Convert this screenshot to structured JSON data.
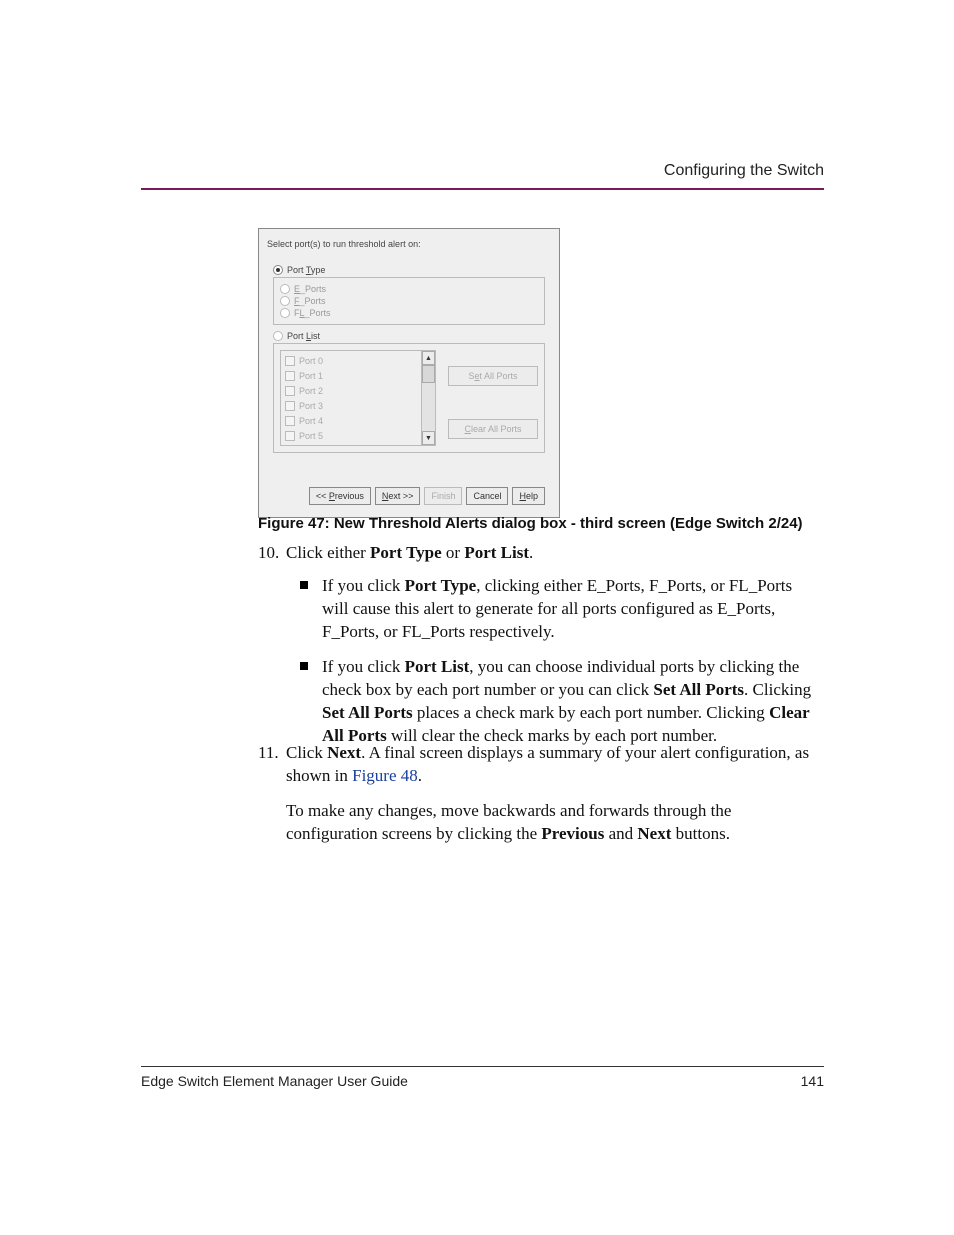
{
  "header": {
    "title": "Configuring the Switch"
  },
  "dialog": {
    "instruction": "Select port(s) to run threshold alert on:",
    "port_type_label_pre": "Port ",
    "port_type_label_u": "T",
    "port_type_label_post": "ype",
    "e_ports_u": "E",
    "e_ports_rest": "_Ports",
    "f_ports_u": "F",
    "f_ports_rest": "_Ports",
    "fl_ports_pre": "F",
    "fl_ports_u": "L",
    "fl_ports_rest": "_Ports",
    "port_list_label_pre": "Port ",
    "port_list_label_u": "L",
    "port_list_label_post": "ist",
    "ports": [
      "Port 0",
      "Port 1",
      "Port 2",
      "Port 3",
      "Port 4",
      "Port 5"
    ],
    "set_all_pre": "S",
    "set_all_u": "e",
    "set_all_post": "t All Ports",
    "clear_all_u": "C",
    "clear_all_post": "lear All Ports",
    "buttons": {
      "previous_pre": "<< ",
      "previous_u": "P",
      "previous_post": "revious",
      "next_u": "N",
      "next_post": "ext >>",
      "finish": "Finish",
      "cancel": "Cancel",
      "help_u": "H",
      "help_post": "elp"
    }
  },
  "caption": "Figure 47:  New Threshold Alerts dialog box - third screen (Edge Switch 2/24)",
  "step10": {
    "num": "10.",
    "text_pre": "Click either ",
    "pt": "Port Type",
    "or": " or ",
    "pl": "Port List",
    "period": ".",
    "bullet1_pre": "If you click ",
    "bullet1_bold": "Port Type",
    "bullet1_post": ", clicking either E_Ports, F_Ports, or FL_Ports will cause this alert to generate for all ports configured as E_Ports, F_Ports, or FL_Ports respectively.",
    "bullet2_pre": "If you click ",
    "bullet2_bold1": "Port List",
    "bullet2_mid1": ", you can choose individual ports by clicking the check box by each port number or you can click ",
    "bullet2_bold2": "Set All Ports",
    "bullet2_mid2": ". Clicking ",
    "bullet2_bold3": "Set All Ports",
    "bullet2_mid3": " places a check mark by each port number. Clicking ",
    "bullet2_bold4": "Clear All Ports",
    "bullet2_post": " will clear the check marks by each port number."
  },
  "step11": {
    "num": "11.",
    "text_pre": "Click ",
    "next_bold": "Next",
    "text_mid": ". A final screen displays a summary of your alert configuration, as shown in ",
    "fig_link": "Figure 48",
    "text_post": ".",
    "para2_pre": "To make any changes, move backwards and forwards through the configuration screens by clicking the ",
    "prev_bold": "Previous",
    "para2_mid": " and ",
    "next_bold2": "Next",
    "para2_post": " buttons."
  },
  "footer": {
    "left": "Edge Switch Element Manager User Guide",
    "right": "141"
  }
}
